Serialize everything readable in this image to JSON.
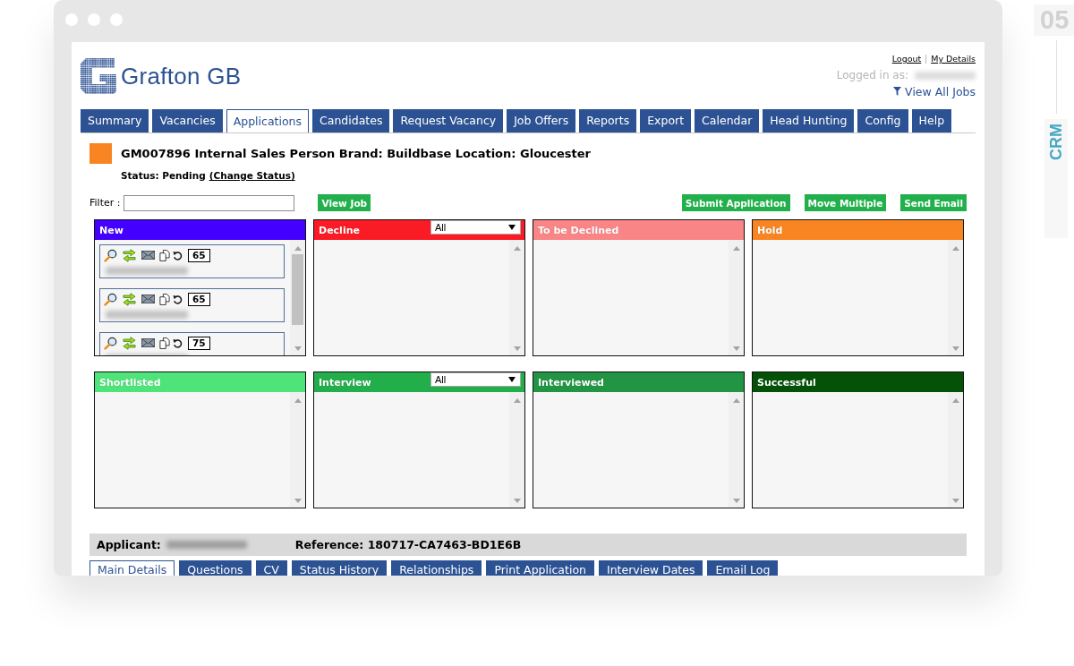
{
  "side_badge": {
    "number": "05",
    "label": "CRM"
  },
  "header": {
    "brand": "Grafton GB",
    "links": [
      "Logout",
      "My Details"
    ],
    "logged_in_label": "Logged in as:",
    "view_all_jobs": "View All Jobs"
  },
  "tabs": [
    {
      "label": "Summary",
      "selected": false
    },
    {
      "label": "Vacancies",
      "selected": false
    },
    {
      "label": "Applications",
      "selected": true
    },
    {
      "label": "Candidates",
      "selected": false
    },
    {
      "label": "Request Vacancy",
      "selected": false
    },
    {
      "label": "Job Offers",
      "selected": false
    },
    {
      "label": "Reports",
      "selected": false
    },
    {
      "label": "Export",
      "selected": false
    },
    {
      "label": "Calendar",
      "selected": false
    },
    {
      "label": "Head Hunting",
      "selected": false
    },
    {
      "label": "Config",
      "selected": false
    },
    {
      "label": "Help",
      "selected": false
    }
  ],
  "job": {
    "title": "GM007896 Internal Sales Person Brand: Buildbase Location: Gloucester",
    "status": "Status: Pending",
    "change_status": "(Change Status)"
  },
  "toolbar": {
    "filter_label": "Filter :",
    "view_job": "View Job",
    "actions": [
      "Submit Application",
      "Move Multiple",
      "Send Email"
    ]
  },
  "stages": [
    {
      "name": "New",
      "color": "#4400ff",
      "cards": [
        {
          "score": "65"
        },
        {
          "score": "65"
        },
        {
          "score": "75"
        }
      ]
    },
    {
      "name": "Decline",
      "color": "#fb1b25",
      "dropdown": "All"
    },
    {
      "name": "To be Declined",
      "color": "#fa8587"
    },
    {
      "name": "Hold",
      "color": "#f98522"
    },
    {
      "name": "Shortlisted",
      "color": "#4fe47a"
    },
    {
      "name": "Interview",
      "color": "#23ae4c",
      "dropdown": "All"
    },
    {
      "name": "Interviewed",
      "color": "#219544"
    },
    {
      "name": "Successful",
      "color": "#035208"
    }
  ],
  "applicant": {
    "label": "Applicant:",
    "reference": "Reference: 180717-CA7463-BD1E6B"
  },
  "detail_tabs": [
    {
      "label": "Main Details",
      "selected": true
    },
    {
      "label": "Questions",
      "selected": false
    },
    {
      "label": "CV",
      "selected": false
    },
    {
      "label": "Status History",
      "selected": false
    },
    {
      "label": "Relationships",
      "selected": false
    },
    {
      "label": "Print Application",
      "selected": false
    },
    {
      "label": "Interview Dates",
      "selected": false
    },
    {
      "label": "Email Log",
      "selected": false
    }
  ]
}
